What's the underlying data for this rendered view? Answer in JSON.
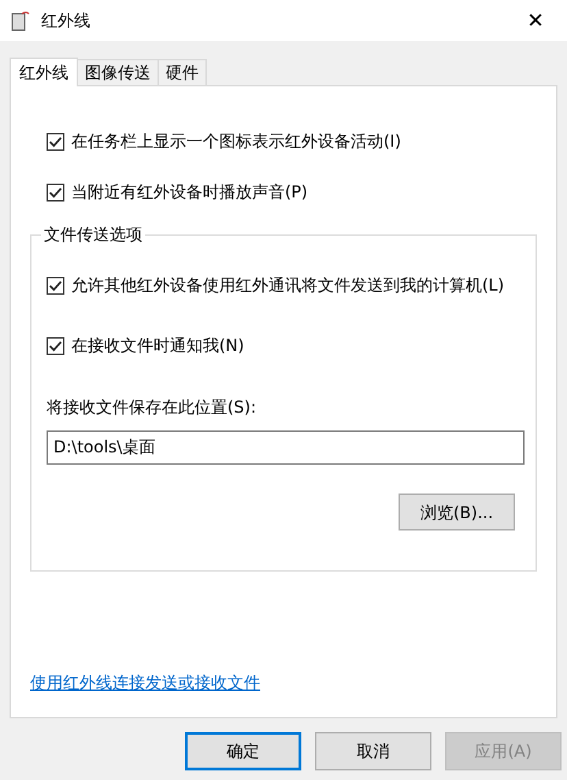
{
  "window": {
    "title": "红外线",
    "close": "✕"
  },
  "tabs": [
    {
      "label": "红外线",
      "selected": true
    },
    {
      "label": "图像传送",
      "selected": false
    },
    {
      "label": "硬件",
      "selected": false
    }
  ],
  "options": [
    {
      "label": "在任务栏上显示一个图标表示红外设备活动(I)",
      "checked": true
    },
    {
      "label": "当附近有红外设备时播放声音(P)",
      "checked": true
    }
  ],
  "file_transfer": {
    "title": "文件传送选项",
    "options": [
      {
        "label": "允许其他红外设备使用红外通讯将文件发送到我的计算机(L)",
        "checked": true
      },
      {
        "label": "在接收文件时通知我(N)",
        "checked": true
      }
    ],
    "save_label": "将接收文件保存在此位置(S):",
    "save_path": "D:\\tools\\桌面",
    "browse": "浏览(B)..."
  },
  "link": "使用红外线连接发送或接收文件",
  "buttons": [
    {
      "label": "确定",
      "kind": "default",
      "disabled": false
    },
    {
      "label": "取消",
      "kind": "normal",
      "disabled": false
    },
    {
      "label": "应用(A)",
      "kind": "normal",
      "disabled": true
    }
  ]
}
